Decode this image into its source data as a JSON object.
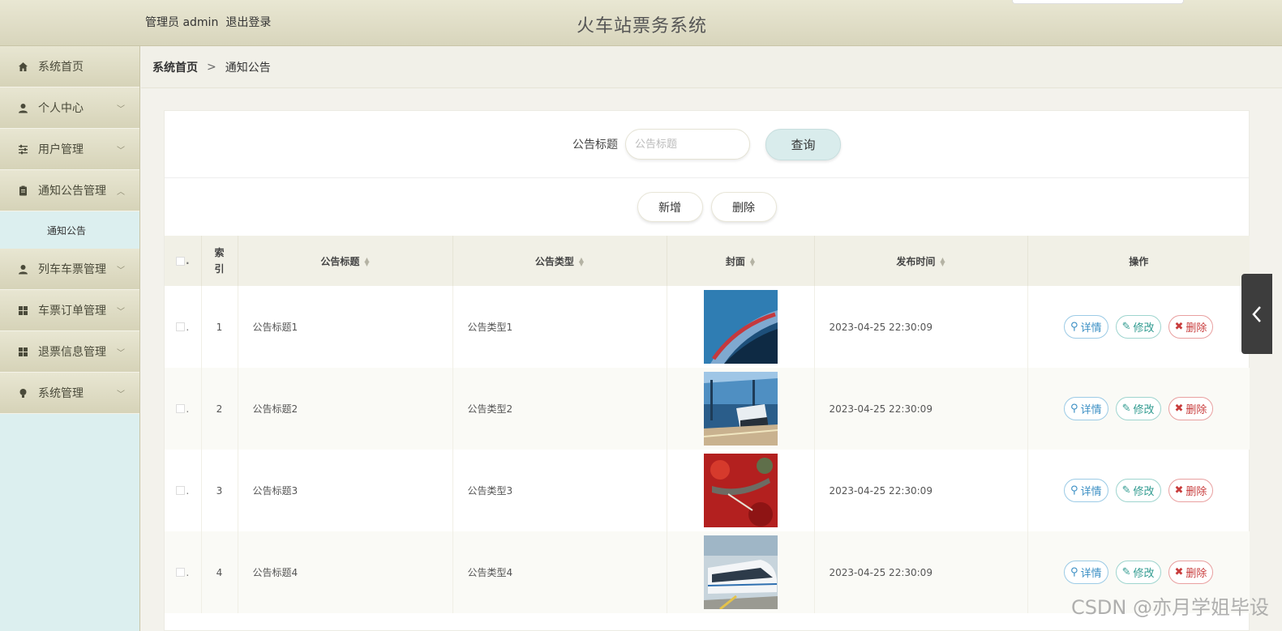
{
  "header": {
    "admin_label": "管理员 admin",
    "logout_label": "退出登录",
    "app_title": "火车站票务系统"
  },
  "sidebar": {
    "items": [
      {
        "label": "系统首页",
        "icon": "home-icon"
      },
      {
        "label": "个人中心",
        "icon": "user-icon"
      },
      {
        "label": "用户管理",
        "icon": "sliders-icon"
      },
      {
        "label": "通知公告管理",
        "icon": "clipboard-icon"
      },
      {
        "label": "列车车票管理",
        "icon": "user-icon"
      },
      {
        "label": "车票订单管理",
        "icon": "grid-icon"
      },
      {
        "label": "退票信息管理",
        "icon": "grid-icon"
      },
      {
        "label": "系统管理",
        "icon": "bulb-icon"
      }
    ],
    "submenu": {
      "label": "通知公告"
    }
  },
  "breadcrumb": {
    "home": "系统首页",
    "separator": ">",
    "current": "通知公告"
  },
  "search": {
    "label": "公告标题",
    "placeholder": "公告标题",
    "query_label": "查询"
  },
  "actions": {
    "add_label": "新增",
    "delete_label": "删除"
  },
  "table": {
    "headers": {
      "index": "索引",
      "title": "公告标题",
      "type": "公告类型",
      "cover": "封面",
      "time": "发布时间",
      "ops": "操作"
    },
    "rows": [
      {
        "index": "1",
        "title": "公告标题1",
        "type": "公告类型1",
        "time": "2023-04-25 22:30:09"
      },
      {
        "index": "2",
        "title": "公告标题2",
        "type": "公告类型2",
        "time": "2023-04-25 22:30:09"
      },
      {
        "index": "3",
        "title": "公告标题3",
        "type": "公告类型3",
        "time": "2023-04-25 22:30:09"
      },
      {
        "index": "4",
        "title": "公告标题4",
        "type": "公告类型4",
        "time": "2023-04-25 22:30:09"
      }
    ],
    "op_labels": {
      "detail": "详情",
      "edit": "修改",
      "delete": "删除"
    }
  },
  "watermark": "CSDN @亦月学姐毕设",
  "colors": {
    "sidebar_bg": "#dcefef",
    "header_bg": "#dedbc2",
    "query_btn": "#d9ecec"
  }
}
